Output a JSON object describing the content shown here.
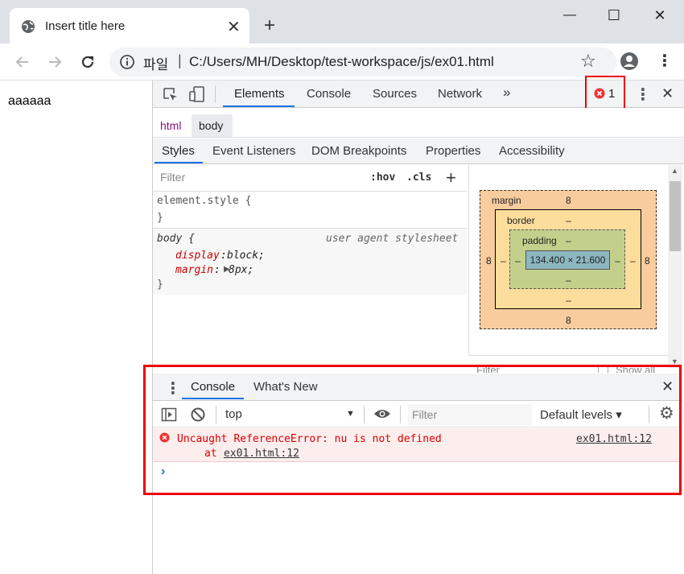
{
  "browser": {
    "tab_title": "Insert title here",
    "new_tab_symbol": "+",
    "window_controls": {
      "minimize": "—",
      "maximize": "☐",
      "close": "✕"
    },
    "omnibox": {
      "security_label": "파일",
      "separator": "|",
      "url": "C:/Users/MH/Desktop/test-workspace/js/ex01.html"
    }
  },
  "page": {
    "body_text": "aaaaaa"
  },
  "devtools": {
    "tabs": [
      "Elements",
      "Console",
      "Sources",
      "Network"
    ],
    "overflow_symbol": "»",
    "error_count": "1",
    "breadcrumb": {
      "html": "html",
      "body": "body"
    },
    "sub_tabs": [
      "Styles",
      "Event Listeners",
      "DOM Breakpoints",
      "Properties",
      "Accessibility"
    ],
    "styles": {
      "filter_placeholder": "Filter",
      "hov": ":hov",
      "cls": ".cls",
      "add": "+",
      "element_style_open": "element.style {",
      "close_brace": "}",
      "body_selector": "body {",
      "body_source": "user agent stylesheet",
      "prop1_name": "display",
      "prop1_value": " block;",
      "prop2_name": "margin",
      "prop2_value": " 8px;",
      "colon": ":"
    },
    "box_model": {
      "margin_label": "margin",
      "border_label": "border",
      "padding_label": "padding",
      "margin_top": "8",
      "margin_bottom": "8",
      "margin_left": "8",
      "margin_right": "8",
      "dash": "–",
      "content_size": "134.400 × 21.600"
    },
    "hidden_filter": "Filter",
    "hidden_show_all": "Show all"
  },
  "console_drawer": {
    "tabs": [
      "Console",
      "What's New"
    ],
    "context": "top",
    "filter_placeholder": "Filter",
    "levels": "Default levels ▾",
    "error": {
      "message": "Uncaught ReferenceError: nu is not defined",
      "source": "ex01.html:12",
      "stack_prefix": "at ",
      "stack_link": "ex01.html:12"
    },
    "prompt": "›"
  },
  "colors": {
    "accent": "#1a73e8",
    "error": "#d00000",
    "highlight_box": "#e00000"
  }
}
